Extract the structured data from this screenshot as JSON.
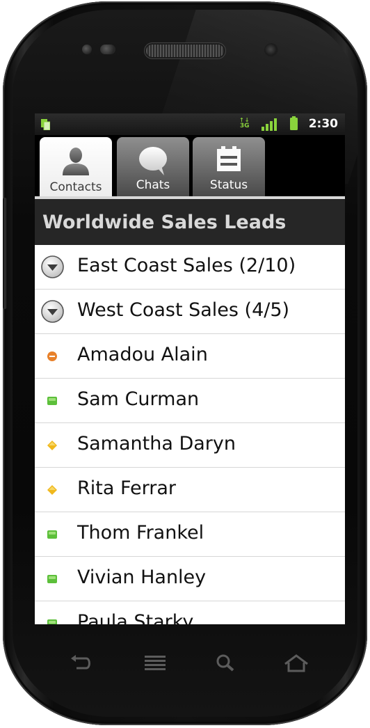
{
  "status_bar": {
    "time": "2:30",
    "network_type": "3G",
    "icons": [
      "notification-icon",
      "data-activity-icon",
      "signal-icon",
      "battery-icon"
    ]
  },
  "tabs": [
    {
      "label": "Contacts",
      "icon": "person-icon",
      "active": true
    },
    {
      "label": "Chats",
      "icon": "speech-bubble-icon",
      "active": false
    },
    {
      "label": "Status",
      "icon": "status-board-icon",
      "active": false
    }
  ],
  "list": {
    "title": "Worldwide Sales Leads",
    "groups": [
      {
        "label": "East Coast Sales (2/10)",
        "icon": "expand-chevron-icon"
      },
      {
        "label": "West Coast Sales (4/5)",
        "icon": "expand-chevron-icon"
      }
    ],
    "contacts": [
      {
        "name": "Amadou Alain",
        "status": "busy",
        "color": "#e8812a"
      },
      {
        "name": "Sam Curman",
        "status": "available",
        "color": "#5cbf3a"
      },
      {
        "name": "Samantha Daryn",
        "status": "away",
        "color": "#f0b81c"
      },
      {
        "name": "Rita Ferrar",
        "status": "away",
        "color": "#f0b81c"
      },
      {
        "name": "Thom Frankel",
        "status": "available",
        "color": "#5cbf3a"
      },
      {
        "name": "Vivian Hanley",
        "status": "available",
        "color": "#5cbf3a"
      },
      {
        "name": "Paula Starky",
        "status": "available",
        "color": "#5cbf3a"
      }
    ]
  },
  "nav_keys": [
    "back-icon",
    "menu-icon",
    "search-icon",
    "home-icon"
  ],
  "colors": {
    "title_bar_bg": "#262626",
    "status_bar_bg": "#1f1f1f",
    "available": "#5cbf3a",
    "away": "#f0b81c",
    "busy": "#e8812a"
  }
}
